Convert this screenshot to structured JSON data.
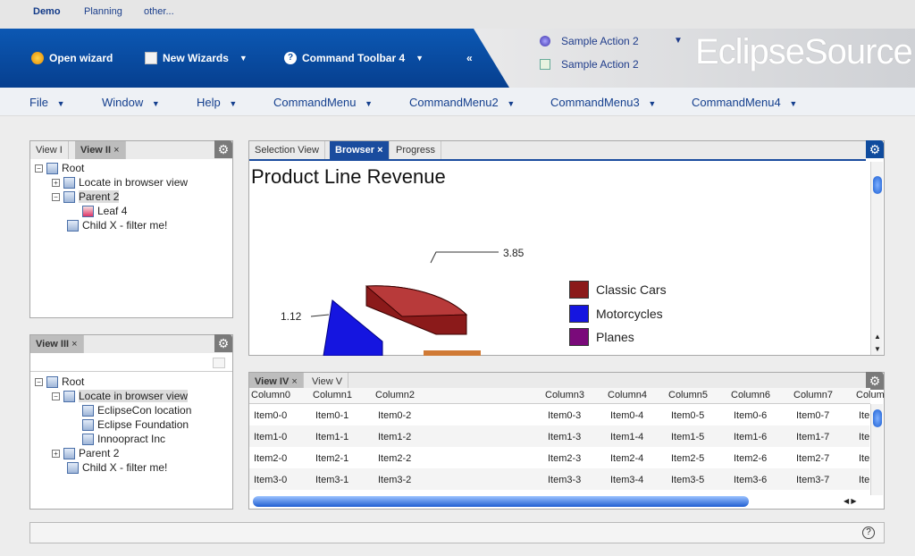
{
  "top_nav": [
    "Demo",
    "Planning",
    "other..."
  ],
  "toolbar": {
    "open_wizard": "Open wizard",
    "new_wizards": "New Wizards",
    "command_toolbar": "Command Toolbar 4",
    "collapse": "«",
    "sample1": "Sample Action 2",
    "sample2": "Sample Action 2",
    "brand": "EclipseSource"
  },
  "menus": [
    "File",
    "Window",
    "Help",
    "CommandMenu",
    "CommandMenu2",
    "CommandMenu3",
    "CommandMenu4"
  ],
  "view1": {
    "tabs": [
      "View I",
      "View II"
    ],
    "tree": [
      "Root",
      "Locate in browser view",
      "Parent 2",
      "Leaf 4",
      "Child X - filter me!"
    ]
  },
  "view3": {
    "tabs": [
      "View III"
    ],
    "tree": [
      "Root",
      "Locate in browser view",
      "EclipseCon location",
      "Eclipse Foundation",
      "Innoopract Inc",
      "Parent 2",
      "Child X - filter me!"
    ]
  },
  "browser": {
    "tabs": [
      "Selection View",
      "Browser",
      "Progress"
    ]
  },
  "chart_data": {
    "type": "pie",
    "title": "Product Line Revenue",
    "data_labels": [
      "3.85",
      "1.12"
    ],
    "legend": [
      "Classic Cars",
      "Motorcycles",
      "Planes"
    ],
    "colors": [
      "#8b1a1a",
      "#1515e0",
      "#7a0a7a"
    ]
  },
  "view4": {
    "tabs": [
      "View IV",
      "View V"
    ],
    "columns": [
      "Column0",
      "Column1",
      "Column2",
      "Column3",
      "Column4",
      "Column5",
      "Column6",
      "Column7",
      "Colum"
    ],
    "rows": [
      [
        "Item0-0",
        "Item0-1",
        "Item0-2",
        "Item0-3",
        "Item0-4",
        "Item0-5",
        "Item0-6",
        "Item0-7",
        "Ite"
      ],
      [
        "Item1-0",
        "Item1-1",
        "Item1-2",
        "Item1-3",
        "Item1-4",
        "Item1-5",
        "Item1-6",
        "Item1-7",
        "Ite"
      ],
      [
        "Item2-0",
        "Item2-1",
        "Item2-2",
        "Item2-3",
        "Item2-4",
        "Item2-5",
        "Item2-6",
        "Item2-7",
        "Ite"
      ],
      [
        "Item3-0",
        "Item3-1",
        "Item3-2",
        "Item3-3",
        "Item3-4",
        "Item3-5",
        "Item3-6",
        "Item3-7",
        "Ite"
      ]
    ]
  },
  "status": {
    "help": "?"
  }
}
